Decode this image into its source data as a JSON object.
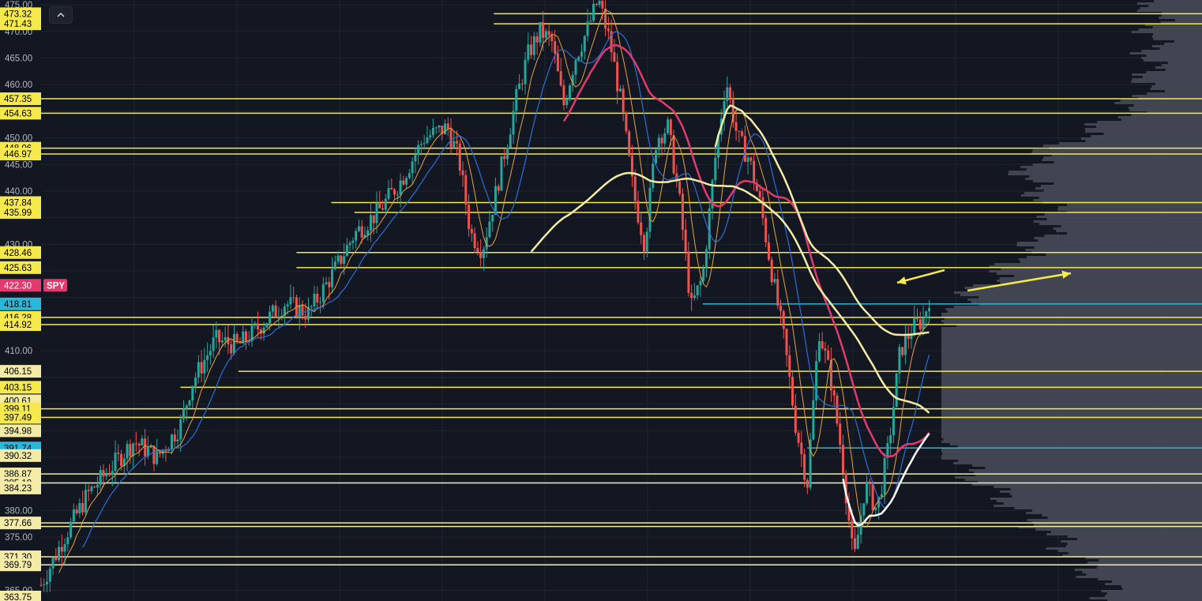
{
  "chart_data": {
    "type": "candlestick",
    "symbol": "SPY",
    "last_price": "422.30",
    "ylim": [
      363.75,
      475.0
    ],
    "axis_ticks": [
      "475.00",
      "470.00",
      "465.00",
      "460.00",
      "450.00",
      "445.00",
      "440.00",
      "430.00",
      "410.00",
      "380.00",
      "375.00",
      "365.00"
    ],
    "price_labels": [
      {
        "text": "473.32",
        "value": 473.32,
        "color": "#f5e94c",
        "text_color": "#000000"
      },
      {
        "text": "471.43",
        "value": 471.43,
        "color": "#f5e94c",
        "text_color": "#000000"
      },
      {
        "text": "457.35",
        "value": 457.35,
        "color": "#f5e94c",
        "text_color": "#000000"
      },
      {
        "text": "454.63",
        "value": 454.63,
        "color": "#f5e94c",
        "text_color": "#000000"
      },
      {
        "text": "448.06",
        "value": 448.06,
        "color": "#f5e94c",
        "text_color": "#000000"
      },
      {
        "text": "446.97",
        "value": 446.97,
        "color": "#f5e94c",
        "text_color": "#000000"
      },
      {
        "text": "437.84",
        "value": 437.84,
        "color": "#f5e94c",
        "text_color": "#000000"
      },
      {
        "text": "435.99",
        "value": 435.99,
        "color": "#f5e94c",
        "text_color": "#000000"
      },
      {
        "text": "428.46",
        "value": 428.46,
        "color": "#f5e94c",
        "text_color": "#000000"
      },
      {
        "text": "425.63",
        "value": 425.63,
        "color": "#f5e94c",
        "text_color": "#000000"
      },
      {
        "text": "422.30",
        "value": 422.3,
        "color": "#e03a6e",
        "text_color": "#ffffff"
      },
      {
        "text": "418.81",
        "value": 418.81,
        "color": "#2ab7d8",
        "text_color": "#000000"
      },
      {
        "text": "416.28",
        "value": 416.28,
        "color": "#f5e94c",
        "text_color": "#000000"
      },
      {
        "text": "414.92",
        "value": 414.92,
        "color": "#f5e94c",
        "text_color": "#000000"
      },
      {
        "text": "406.15",
        "value": 406.15,
        "color": "#f3eba6",
        "text_color": "#000000"
      },
      {
        "text": "403.15",
        "value": 403.15,
        "color": "#f5e94c",
        "text_color": "#000000"
      },
      {
        "text": "400.61",
        "value": 400.61,
        "color": "#f3eba6",
        "text_color": "#000000"
      },
      {
        "text": "399.11",
        "value": 399.11,
        "color": "#f5e94c",
        "text_color": "#000000"
      },
      {
        "text": "397.49",
        "value": 397.49,
        "color": "#f5e94c",
        "text_color": "#000000"
      },
      {
        "text": "394.98",
        "value": 394.98,
        "color": "#f3eba6",
        "text_color": "#000000"
      },
      {
        "text": "391.74",
        "value": 391.74,
        "color": "#2ab7d8",
        "text_color": "#000000"
      },
      {
        "text": "390.32",
        "value": 390.32,
        "color": "#f3eba6",
        "text_color": "#000000"
      },
      {
        "text": "386.87",
        "value": 386.87,
        "color": "#f3eba6",
        "text_color": "#000000"
      },
      {
        "text": "385.18",
        "value": 385.18,
        "color": "#f3eba6",
        "text_color": "#000000"
      },
      {
        "text": "384.23",
        "value": 384.23,
        "color": "#f3eba6",
        "text_color": "#000000"
      },
      {
        "text": "377.66",
        "value": 377.66,
        "color": "#f3eba6",
        "text_color": "#000000"
      },
      {
        "text": "371.30",
        "value": 371.3,
        "color": "#f3eba6",
        "text_color": "#000000"
      },
      {
        "text": "369.79",
        "value": 369.79,
        "color": "#f3eba6",
        "text_color": "#000000"
      },
      {
        "text": "363.75",
        "value": 363.75,
        "color": "#f3eba6",
        "text_color": "#000000"
      }
    ],
    "symbol_tag": {
      "text": "SPY",
      "color": "#e03a6e",
      "value": 422.3
    },
    "horizontal_levels": [
      {
        "value": 473.32,
        "start_frac": 0.39,
        "color": "#f5e94c"
      },
      {
        "value": 471.43,
        "start_frac": 0.39,
        "color": "#f5e94c"
      },
      {
        "value": 457.35,
        "start_frac": 0.0,
        "color": "#f5e94c"
      },
      {
        "value": 454.63,
        "start_frac": 0.0,
        "color": "#f5e94c"
      },
      {
        "value": 448.06,
        "start_frac": 0.0,
        "color": "#f5e94c"
      },
      {
        "value": 446.97,
        "start_frac": 0.0,
        "color": "#f5e94c"
      },
      {
        "value": 437.84,
        "start_frac": 0.25,
        "color": "#f5e94c"
      },
      {
        "value": 435.99,
        "start_frac": 0.27,
        "color": "#f5e94c"
      },
      {
        "value": 428.46,
        "start_frac": 0.22,
        "color": "#f5e94c"
      },
      {
        "value": 425.63,
        "start_frac": 0.22,
        "color": "#f5e94c"
      },
      {
        "value": 418.81,
        "start_frac": 0.57,
        "color": "#2ab7d8"
      },
      {
        "value": 416.28,
        "start_frac": 0.0,
        "color": "#f5e94c"
      },
      {
        "value": 414.92,
        "start_frac": 0.0,
        "color": "#f5e94c"
      },
      {
        "value": 406.15,
        "start_frac": 0.17,
        "color": "#f5e94c"
      },
      {
        "value": 403.15,
        "start_frac": 0.12,
        "color": "#f5e94c"
      },
      {
        "value": 399.11,
        "start_frac": 0.0,
        "color": "#f5e94c"
      },
      {
        "value": 397.49,
        "start_frac": 0.0,
        "color": "#f5e94c"
      },
      {
        "value": 391.74,
        "start_frac": 0.66,
        "color": "#2ab7d8"
      },
      {
        "value": 386.87,
        "start_frac": 0.0,
        "color": "#f3eba6"
      },
      {
        "value": 385.18,
        "start_frac": 0.0,
        "color": "#f3eba6"
      },
      {
        "value": 377.66,
        "start_frac": 0.0,
        "color": "#f3eba6"
      },
      {
        "value": 377.0,
        "start_frac": 0.0,
        "color": "#f3eba6"
      },
      {
        "value": 371.3,
        "start_frac": 0.0,
        "color": "#f3eba6"
      },
      {
        "value": 369.79,
        "start_frac": 0.0,
        "color": "#f3eba6"
      }
    ],
    "price_path": [
      [
        0.0,
        366
      ],
      [
        0.02,
        375
      ],
      [
        0.04,
        383
      ],
      [
        0.06,
        388
      ],
      [
        0.08,
        393
      ],
      [
        0.1,
        390
      ],
      [
        0.12,
        396
      ],
      [
        0.13,
        404
      ],
      [
        0.15,
        412
      ],
      [
        0.17,
        411
      ],
      [
        0.19,
        415
      ],
      [
        0.21,
        419
      ],
      [
        0.23,
        417
      ],
      [
        0.25,
        424
      ],
      [
        0.27,
        432
      ],
      [
        0.29,
        436
      ],
      [
        0.31,
        442
      ],
      [
        0.33,
        450
      ],
      [
        0.35,
        452
      ],
      [
        0.36,
        446
      ],
      [
        0.37,
        432
      ],
      [
        0.38,
        429
      ],
      [
        0.39,
        438
      ],
      [
        0.4,
        448
      ],
      [
        0.41,
        458
      ],
      [
        0.42,
        466
      ],
      [
        0.43,
        470
      ],
      [
        0.44,
        468
      ],
      [
        0.45,
        456
      ],
      [
        0.46,
        465
      ],
      [
        0.47,
        470
      ],
      [
        0.48,
        476
      ],
      [
        0.49,
        468
      ],
      [
        0.5,
        456
      ],
      [
        0.51,
        440
      ],
      [
        0.52,
        430
      ],
      [
        0.53,
        450
      ],
      [
        0.54,
        452
      ],
      [
        0.55,
        438
      ],
      [
        0.56,
        418
      ],
      [
        0.57,
        424
      ],
      [
        0.58,
        445
      ],
      [
        0.59,
        461
      ],
      [
        0.6,
        450
      ],
      [
        0.61,
        446
      ],
      [
        0.62,
        437
      ],
      [
        0.63,
        424
      ],
      [
        0.64,
        412
      ],
      [
        0.65,
        396
      ],
      [
        0.66,
        385
      ],
      [
        0.67,
        414
      ],
      [
        0.68,
        405
      ],
      [
        0.69,
        390
      ],
      [
        0.7,
        370
      ],
      [
        0.71,
        385
      ],
      [
        0.72,
        380
      ],
      [
        0.73,
        392
      ],
      [
        0.74,
        410
      ],
      [
        0.75,
        414
      ],
      [
        0.76,
        416
      ],
      [
        0.765,
        420
      ]
    ],
    "volume_profile_peak_value": 404,
    "annotations": [
      "arrow pointing left at 422.30",
      "arrow pointing up-right"
    ]
  }
}
